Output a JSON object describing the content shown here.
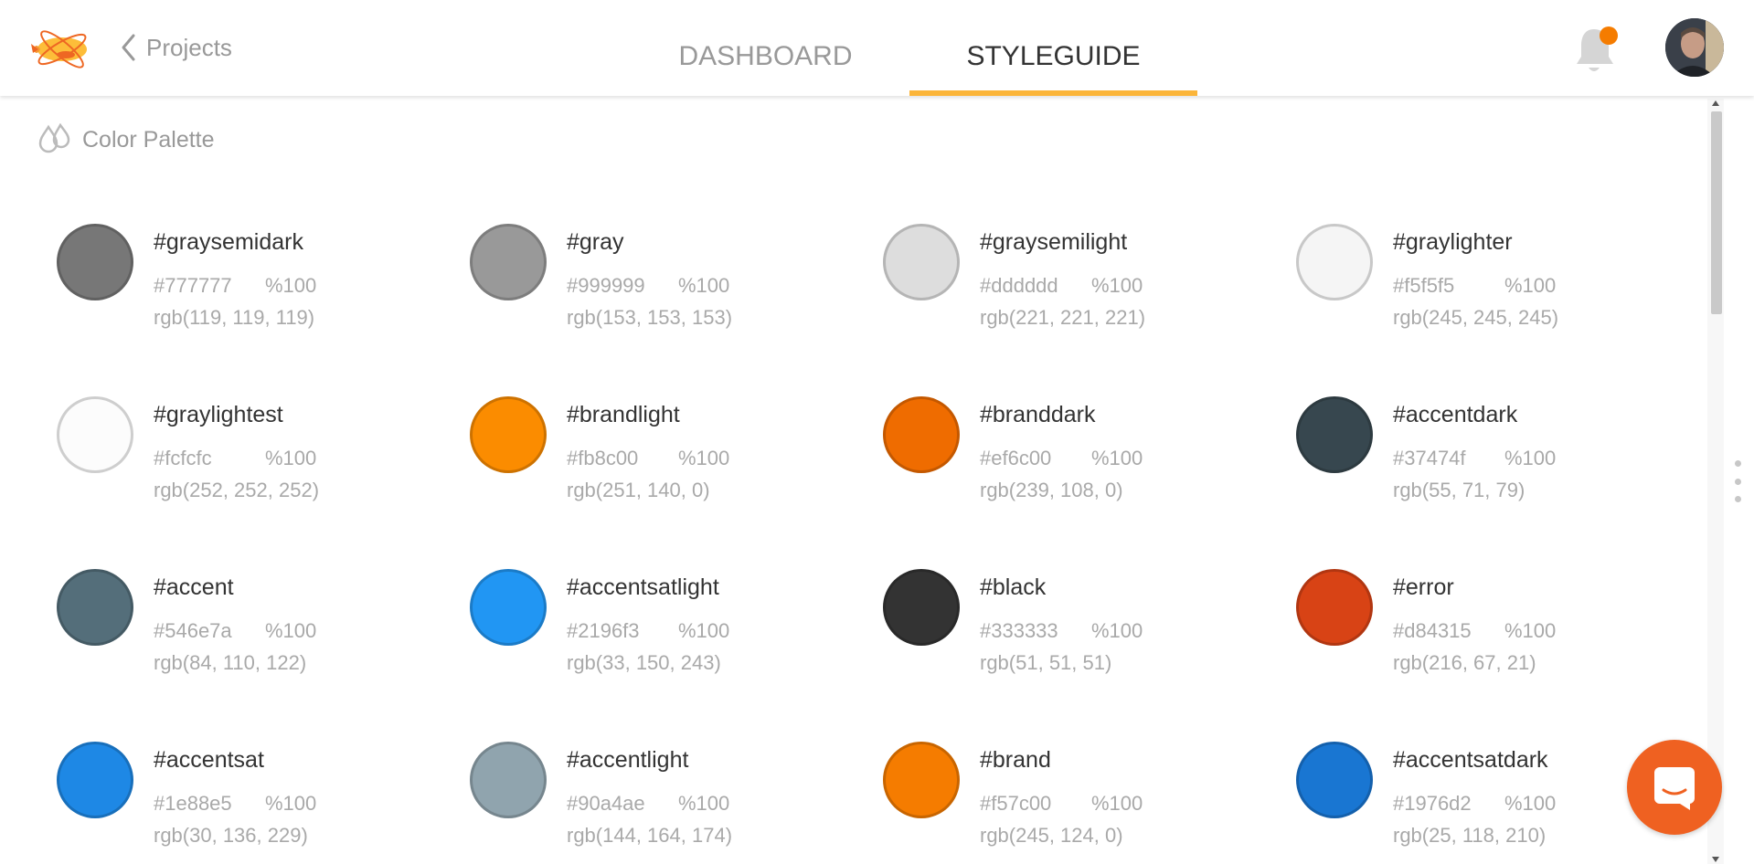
{
  "header": {
    "back_label": "Projects",
    "tabs": [
      {
        "label": "DASHBOARD",
        "active": false
      },
      {
        "label": "STYLEGUIDE",
        "active": true
      }
    ],
    "accent_color": "#fbb53a",
    "notification_dot_color": "#f57c00"
  },
  "section": {
    "title": "Color Palette",
    "icon": "drops-icon"
  },
  "colors": [
    {
      "name": "#graysemidark",
      "hex": "#777777",
      "opacity": "%100",
      "rgb": "rgb(119, 119, 119)",
      "swatch": "#777777"
    },
    {
      "name": "#gray",
      "hex": "#999999",
      "opacity": "%100",
      "rgb": "rgb(153, 153, 153)",
      "swatch": "#999999"
    },
    {
      "name": "#graysemilight",
      "hex": "#dddddd",
      "opacity": "%100",
      "rgb": "rgb(221, 221, 221)",
      "swatch": "#dddddd"
    },
    {
      "name": "#graylighter",
      "hex": "#f5f5f5",
      "opacity": "%100",
      "rgb": "rgb(245, 245, 245)",
      "swatch": "#f5f5f5"
    },
    {
      "name": "#graylightest",
      "hex": "#fcfcfc",
      "opacity": "%100",
      "rgb": "rgb(252, 252, 252)",
      "swatch": "#fcfcfc"
    },
    {
      "name": "#brandlight",
      "hex": "#fb8c00",
      "opacity": "%100",
      "rgb": "rgb(251, 140, 0)",
      "swatch": "#fb8c00"
    },
    {
      "name": "#branddark",
      "hex": "#ef6c00",
      "opacity": "%100",
      "rgb": "rgb(239, 108, 0)",
      "swatch": "#ef6c00"
    },
    {
      "name": "#accentdark",
      "hex": "#37474f",
      "opacity": "%100",
      "rgb": "rgb(55, 71, 79)",
      "swatch": "#37474f"
    },
    {
      "name": "#accent",
      "hex": "#546e7a",
      "opacity": "%100",
      "rgb": "rgb(84, 110, 122)",
      "swatch": "#546e7a"
    },
    {
      "name": "#accentsatlight",
      "hex": "#2196f3",
      "opacity": "%100",
      "rgb": "rgb(33, 150, 243)",
      "swatch": "#2196f3"
    },
    {
      "name": "#black",
      "hex": "#333333",
      "opacity": "%100",
      "rgb": "rgb(51, 51, 51)",
      "swatch": "#333333"
    },
    {
      "name": "#error",
      "hex": "#d84315",
      "opacity": "%100",
      "rgb": "rgb(216, 67, 21)",
      "swatch": "#d84315"
    },
    {
      "name": "#accentsat",
      "hex": "#1e88e5",
      "opacity": "%100",
      "rgb": "rgb(30, 136, 229)",
      "swatch": "#1e88e5"
    },
    {
      "name": "#accentlight",
      "hex": "#90a4ae",
      "opacity": "%100",
      "rgb": "rgb(144, 164, 174)",
      "swatch": "#90a4ae"
    },
    {
      "name": "#brand",
      "hex": "#f57c00",
      "opacity": "%100",
      "rgb": "rgb(245, 124, 0)",
      "swatch": "#f57c00"
    },
    {
      "name": "#accentsatdark",
      "hex": "#1976d2",
      "opacity": "%100",
      "rgb": "rgb(25, 118, 210)",
      "swatch": "#1976d2"
    }
  ],
  "chat_button_color": "#ef6121"
}
